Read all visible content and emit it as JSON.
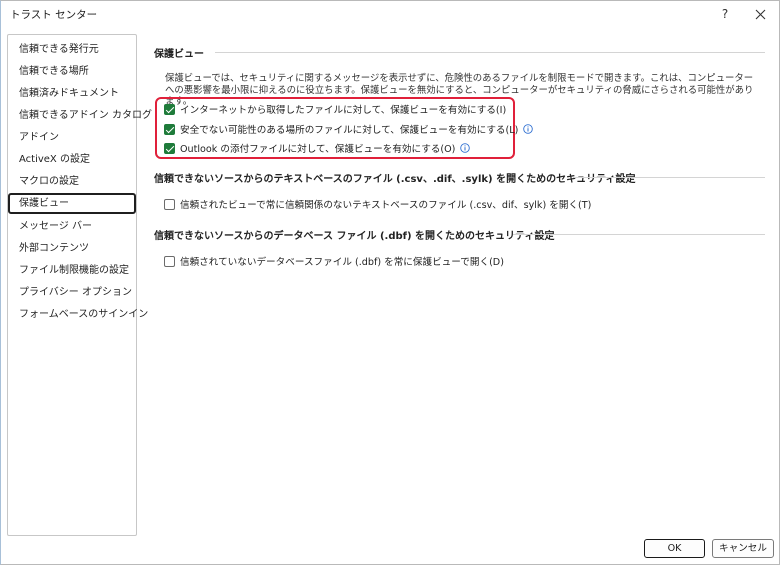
{
  "window": {
    "title": "トラスト センター",
    "help_label": "?"
  },
  "sidebar": {
    "items": [
      {
        "label": "信頼できる発行元"
      },
      {
        "label": "信頼できる場所"
      },
      {
        "label": "信頼済みドキュメント"
      },
      {
        "label": "信頼できるアドイン カタログ"
      },
      {
        "label": "アドイン"
      },
      {
        "label": "ActiveX の設定"
      },
      {
        "label": "マクロの設定"
      },
      {
        "label": "保護ビュー",
        "selected": true
      },
      {
        "label": "メッセージ バー"
      },
      {
        "label": "外部コンテンツ"
      },
      {
        "label": "ファイル制限機能の設定"
      },
      {
        "label": "プライバシー オプション"
      },
      {
        "label": "フォームベースのサインイン"
      }
    ]
  },
  "main": {
    "section1": {
      "heading": "保護ビュー",
      "description": "保護ビューでは、セキュリティに関するメッセージを表示せずに、危険性のあるファイルを制限モードで開きます。これは、コンピューターへの悪影響を最小限に抑えるのに役立ちます。保護ビューを無効にすると、コンピューターがセキュリティの脅威にさらされる可能性があります。",
      "options": [
        {
          "label": "インターネットから取得したファイルに対して、保護ビューを有効にする(I)",
          "checked": true,
          "info": false
        },
        {
          "label": "安全でない可能性のある場所のファイルに対して、保護ビューを有効にする(L)",
          "checked": true,
          "info": true
        },
        {
          "label": "Outlook の添付ファイルに対して、保護ビューを有効にする(O)",
          "checked": true,
          "info": true
        }
      ]
    },
    "section2": {
      "heading": "信頼できないソースからのテキストベースのファイル (.csv、.dif、.sylk) を開くためのセキュリティ設定",
      "option": {
        "label": "信頼されたビューで常に信頼関係のないテキストベースのファイル (.csv、dif、sylk) を開く(T)",
        "checked": false
      }
    },
    "section3": {
      "heading": "信頼できないソースからのデータベース ファイル (.dbf) を開くためのセキュリティ設定",
      "option": {
        "label": "信頼されていないデータベースファイル (.dbf) を常に保護ビューで開く(D)",
        "checked": false
      }
    }
  },
  "footer": {
    "ok_label": "OK",
    "cancel_label": "キャンセル"
  },
  "colors": {
    "checkbox_checked": "#1e7b3a",
    "highlight_border": "#e0203a",
    "info_icon": "#2f6fd1"
  }
}
